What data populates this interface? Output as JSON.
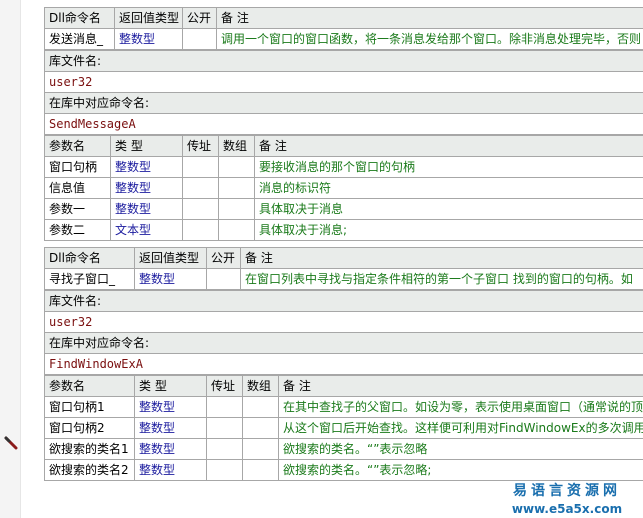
{
  "block1": {
    "headers": [
      "Dll命令名",
      "返回值类型",
      "公开",
      "备 注"
    ],
    "cmd_name": "发送消息_",
    "return_type": "整数型",
    "public": "",
    "remark": "调用一个窗口的窗口函数，将一条消息发给那个窗口。除非消息处理完毕，否则",
    "lib_label": "库文件名:",
    "lib_value": "user32",
    "entry_label": "在库中对应命令名:",
    "entry_value": "SendMessageA",
    "param_headers": [
      "参数名",
      "类 型",
      "传址",
      "数组",
      "备 注"
    ],
    "params": [
      {
        "name": "窗口句柄",
        "type": "整数型",
        "byref": "",
        "array": "",
        "remark": "要接收消息的那个窗口的句柄"
      },
      {
        "name": "信息值",
        "type": "整数型",
        "byref": "",
        "array": "",
        "remark": "消息的标识符"
      },
      {
        "name": "参数一",
        "type": "整数型",
        "byref": "",
        "array": "",
        "remark": "具体取决于消息"
      },
      {
        "name": "参数二",
        "type": "文本型",
        "byref": "",
        "array": "",
        "remark": "具体取决于消息;"
      }
    ]
  },
  "block2": {
    "headers": [
      "Dll命令名",
      "返回值类型",
      "公开",
      "备 注"
    ],
    "cmd_name": "寻找子窗口_",
    "return_type": "整数型",
    "public": "",
    "remark": "在窗口列表中寻找与指定条件相符的第一个子窗口  找到的窗口的句柄。如",
    "lib_label": "库文件名:",
    "lib_value": "user32",
    "entry_label": "在库中对应命令名:",
    "entry_value": "FindWindowExA",
    "param_headers": [
      "参数名",
      "类 型",
      "传址",
      "数组",
      "备 注"
    ],
    "params": [
      {
        "name": "窗口句柄1",
        "type": "整数型",
        "byref": "",
        "array": "",
        "remark": "在其中查找子的父窗口。如设为零，表示使用桌面窗口（通常说的顶"
      },
      {
        "name": "窗口句柄2",
        "type": "整数型",
        "byref": "",
        "array": "",
        "remark": "从这个窗口后开始查找。这样便可利用对FindWindowEx的多次调用找"
      },
      {
        "name": "欲搜索的类名1",
        "type": "整数型",
        "byref": "",
        "array": "",
        "remark": "欲搜索的类名。“”表示忽略"
      },
      {
        "name": "欲搜索的类名2",
        "type": "整数型",
        "byref": "",
        "array": "",
        "remark": "欲搜索的类名。“”表示忽略;"
      }
    ]
  },
  "footer": {
    "brand": "易语言资源网",
    "url": "www.e5a5x.com"
  }
}
